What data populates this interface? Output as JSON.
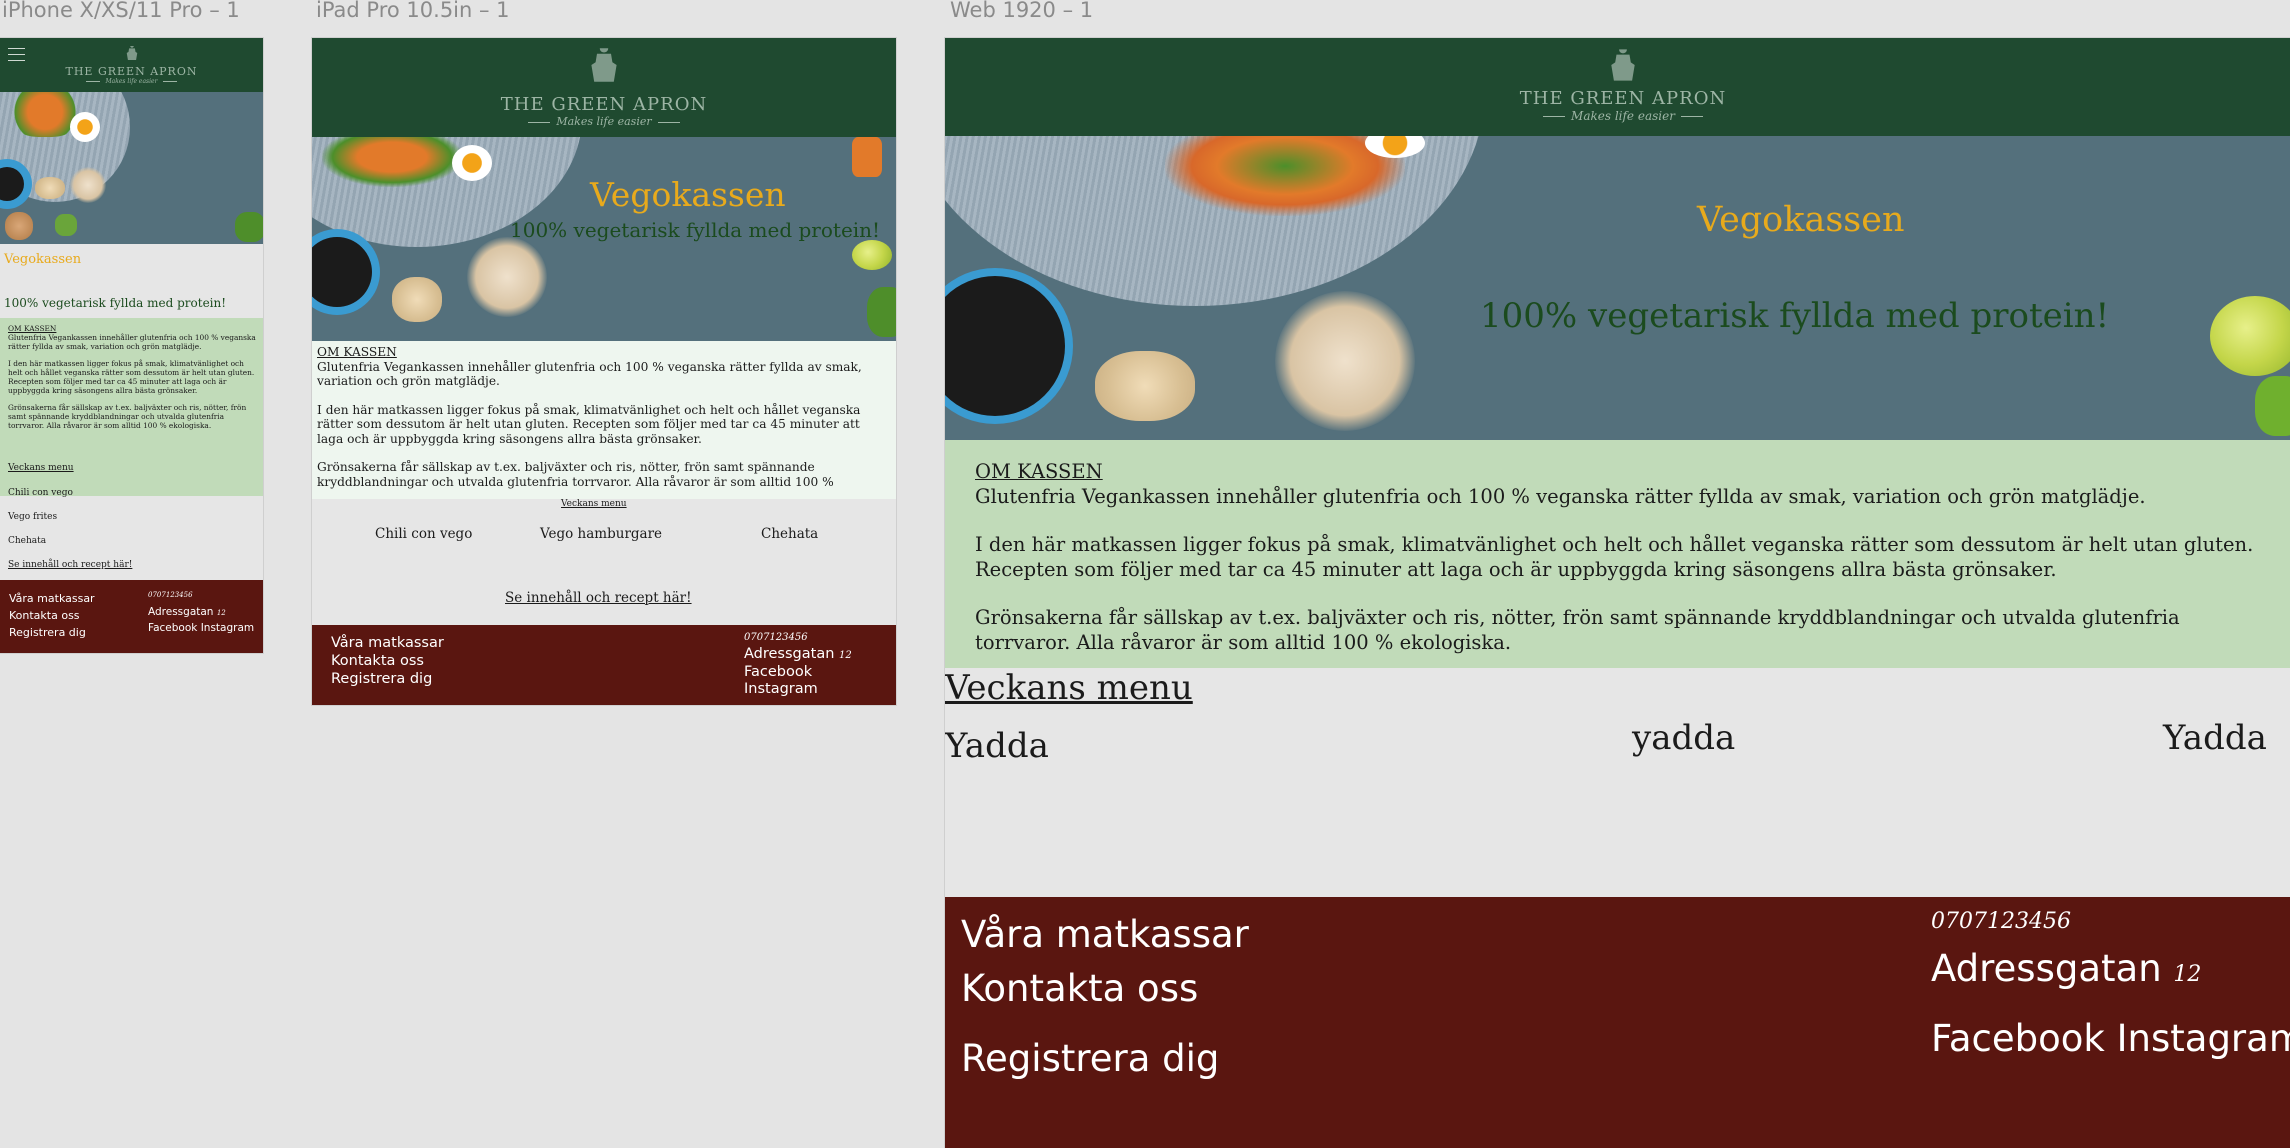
{
  "artboards": {
    "phone": {
      "label": "iPhone X/XS/11 Pro – 1"
    },
    "tablet": {
      "label": "iPad Pro 10.5in – 1"
    },
    "web": {
      "label": "Web 1920 – 1"
    }
  },
  "brand": {
    "name": "THE GREEN APRON",
    "tagline": "Makes life easier"
  },
  "hero": {
    "title": "Vegokassen",
    "subtitle": "100% vegetarisk fyllda med protein!"
  },
  "about": {
    "heading": "OM KASSEN",
    "p1": "Glutenfria Vegankassen innehåller glutenfria och 100 % veganska rätter fyllda av smak, variation och grön matglädje.",
    "p2": "I den här matkassen ligger fokus på smak, klimatvänlighet och helt och hållet veganska rätter som dessutom är helt utan gluten. Recepten som följer med tar ca 45 minuter att laga och är uppbyggda kring säsongens allra bästa grönsaker.",
    "p3": "Grönsakerna får sällskap av t.ex. baljväxter och ris, nötter, frön samt spännande kryddblandningar och utvalda glutenfria torrvaror. Alla råvaror är som alltid 100 % ekologiska.",
    "tablet_p3": "Grönsakerna får sällskap av t.ex. baljväxter och ris, nötter, frön samt spännande kryddblandningar och utvalda glutenfria torrvaror. Alla råvaror är som alltid 100 %",
    "web_p2_line1": "I den här matkassen ligger fokus på smak, klimatvänlighet och helt och hållet veganska rätter som dessutom är helt utan gluten.",
    "web_p2_line2": "Recepten som följer med tar ca 45 minuter att laga och är uppbyggda kring säsongens allra bästa grönsaker.",
    "web_p3_line1": "Grönsakerna får sällskap av t.ex. baljväxter och ris, nötter, frön samt spännande kryddblandningar och utvalda glutenfria",
    "web_p3_line2": "torrvaror. Alla råvaror är som alltid 100 % ekologiska."
  },
  "menu": {
    "heading": "Veckans menu",
    "items": [
      "Chili con vego",
      "Vego hamburgare",
      "Chehata"
    ],
    "phone_items": [
      "Chili con vego",
      "Vego frites",
      "Chehata"
    ],
    "web_items": [
      "Yadda",
      "yadda",
      "Yadda"
    ],
    "recipe_link": "Se innehåll och recept här!"
  },
  "footer": {
    "links": [
      "Våra matkassar",
      "Kontakta oss",
      "Registrera dig"
    ],
    "phone": "0707123456",
    "address": "Adressgatan",
    "address_no": "12",
    "facebook": "Facebook",
    "instagram": "Instagram"
  },
  "colors": {
    "header_green": "#1f4a30",
    "hero_title": "#e8aa1c",
    "hero_subtitle": "#1b4b1e",
    "about_bg_web": "#c1dbb9",
    "about_bg_tablet": "#eef6ef",
    "footer_red": "#5a1610",
    "canvas": "#e4e4e4"
  },
  "icons": [
    "menu-icon",
    "apron-logo-icon"
  ]
}
